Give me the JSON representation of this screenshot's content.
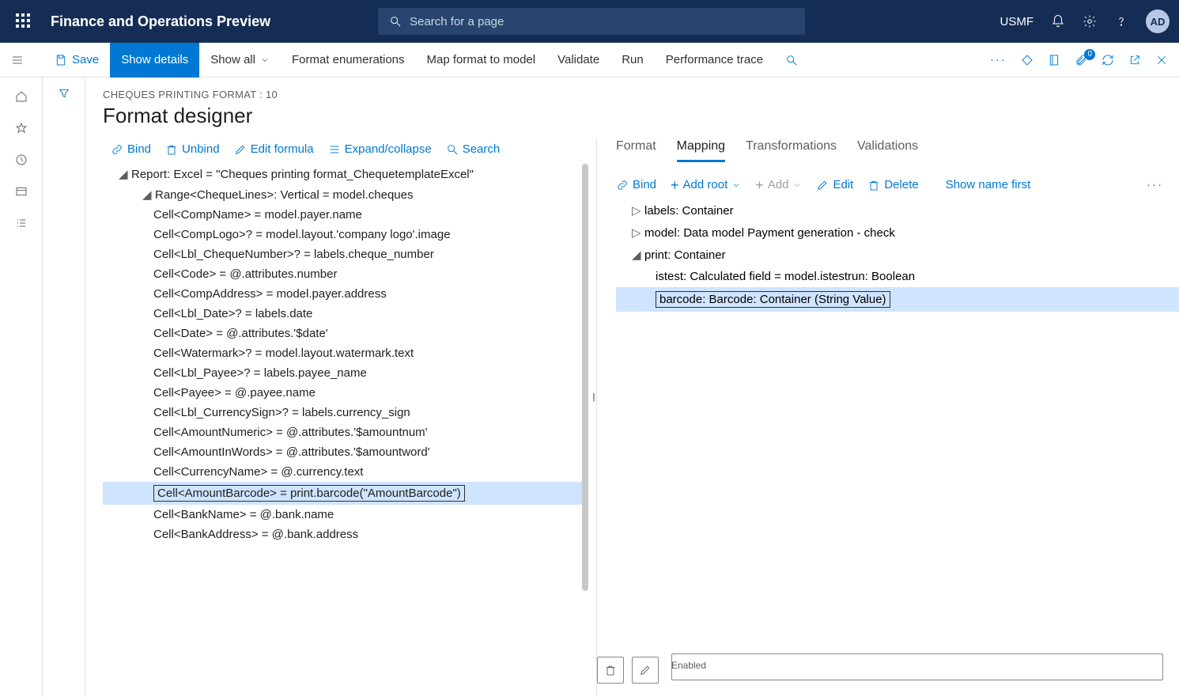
{
  "top": {
    "app_title": "Finance and Operations Preview",
    "search_placeholder": "Search for a page",
    "company": "USMF",
    "avatar": "AD"
  },
  "cmd": {
    "save": "Save",
    "show_details": "Show details",
    "show_all": "Show all",
    "format_enum": "Format enumerations",
    "map_format": "Map format to model",
    "validate": "Validate",
    "run": "Run",
    "perf_trace": "Performance trace",
    "attach_count": "0"
  },
  "page": {
    "crumb": "CHEQUES PRINTING FORMAT : 10",
    "title": "Format designer"
  },
  "ltool": {
    "bind": "Bind",
    "unbind": "Unbind",
    "edit_formula": "Edit formula",
    "expand": "Expand/collapse",
    "search": "Search"
  },
  "tree": {
    "root": "Report: Excel = \"Cheques printing format_ChequetemplateExcel\"",
    "range": "Range<ChequeLines>: Vertical = model.cheques",
    "items": [
      "Cell<CompName> = model.payer.name",
      "Cell<CompLogo>? = model.layout.'company logo'.image",
      "Cell<Lbl_ChequeNumber>? = labels.cheque_number",
      "Cell<Code> = @.attributes.number",
      "Cell<CompAddress> = model.payer.address",
      "Cell<Lbl_Date>? = labels.date",
      "Cell<Date> = @.attributes.'$date'",
      "Cell<Watermark>? = model.layout.watermark.text",
      "Cell<Lbl_Payee>? = labels.payee_name",
      "Cell<Payee> = @.payee.name",
      "Cell<Lbl_CurrencySign>? = labels.currency_sign",
      "Cell<AmountNumeric> = @.attributes.'$amountnum'",
      "Cell<AmountInWords> = @.attributes.'$amountword'",
      "Cell<CurrencyName> = @.currency.text",
      "Cell<AmountBarcode> = print.barcode(\"AmountBarcode\")",
      "Cell<BankName> = @.bank.name",
      "Cell<BankAddress> = @.bank.address"
    ],
    "selected_index": 14
  },
  "tabs": {
    "format": "Format",
    "mapping": "Mapping",
    "transformations": "Transformations",
    "validations": "Validations"
  },
  "rtool": {
    "bind": "Bind",
    "add_root": "Add root",
    "add": "Add",
    "edit": "Edit",
    "delete": "Delete",
    "show_name": "Show name first"
  },
  "rtree": {
    "labels": "labels: Container",
    "model": "model: Data model Payment generation - check",
    "print": "print: Container",
    "istest": "istest: Calculated field = model.istestrun: Boolean",
    "barcode": "barcode: Barcode: Container (String Value)"
  },
  "status": {
    "enabled": "Enabled"
  }
}
